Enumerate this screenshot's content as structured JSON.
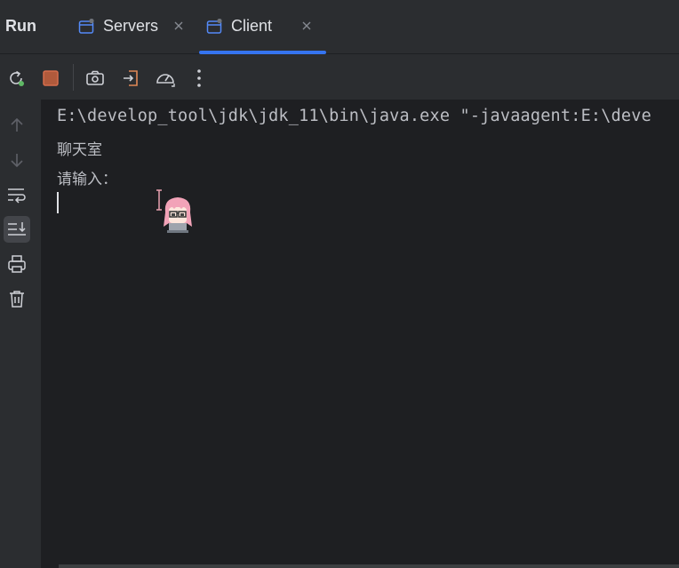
{
  "header": {
    "title": "Run",
    "tabs": [
      {
        "label": "Servers",
        "active": false,
        "icon": "app-window-icon"
      },
      {
        "label": "Client",
        "active": true,
        "icon": "app-window-icon"
      }
    ],
    "close_icon": "close-icon"
  },
  "toolbar": {
    "buttons": [
      "rerun-icon",
      "stop-icon",
      "screenshot-icon",
      "exit-icon",
      "profiler-icon",
      "more-vertical-icon"
    ]
  },
  "gutter": {
    "buttons": [
      "arrow-up-icon",
      "arrow-down-icon",
      "soft-wrap-icon",
      "scroll-to-end-icon",
      "print-icon",
      "trash-icon"
    ],
    "active": "scroll-to-end-icon"
  },
  "console": {
    "command": "E:\\develop_tool\\jdk\\jdk_11\\bin\\java.exe \"-javaagent:E:\\deve",
    "line1": "聊天室",
    "line2": "请输入："
  },
  "colors": {
    "accent": "#3574f0",
    "stop": "#c75450",
    "panel_bg": "#2b2d30",
    "console_bg": "#1e1f22"
  }
}
